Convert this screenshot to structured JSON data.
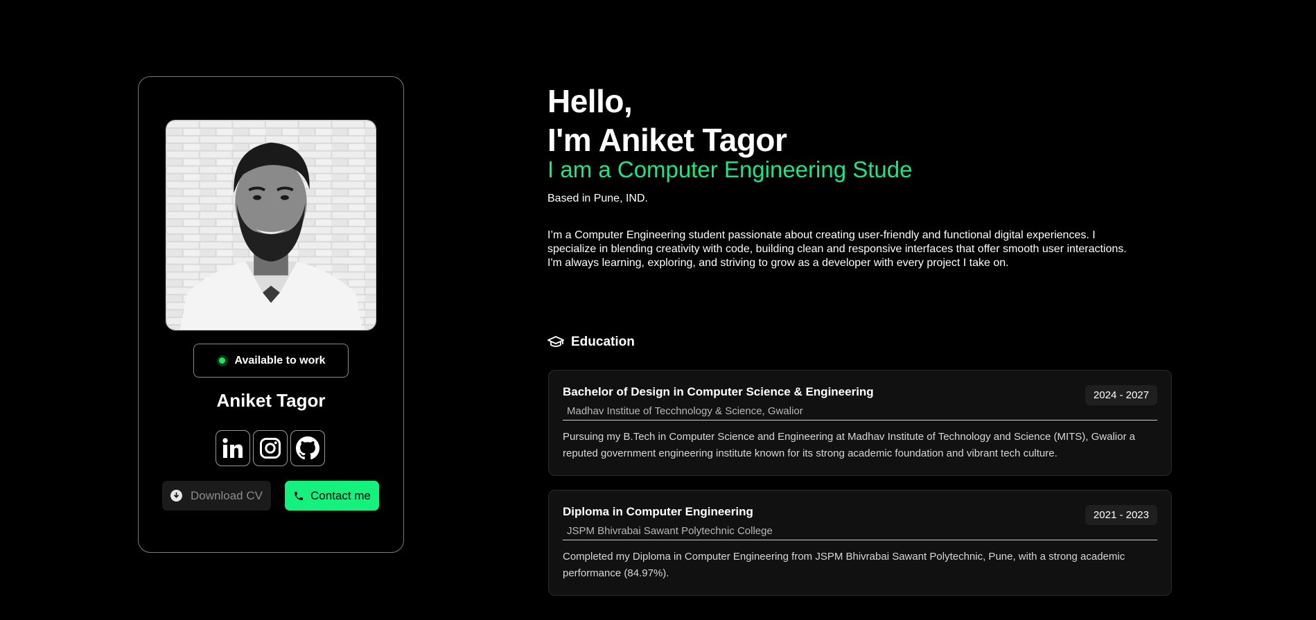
{
  "profile": {
    "photo_alt": "Aniket Tagor portrait",
    "availability": "Available to work",
    "name": "Aniket Tagor",
    "socials": [
      {
        "icon": "linkedin-icon",
        "label": "LinkedIn"
      },
      {
        "icon": "instagram-icon",
        "label": "Instagram"
      },
      {
        "icon": "github-icon",
        "label": "GitHub"
      }
    ],
    "download_label": "Download CV",
    "contact_label": "Contact me"
  },
  "hero": {
    "greeting": "Hello,",
    "intro": "I'm Aniket Tagor",
    "tagline": "I am a Computer Engineering Stude",
    "location": "Based in Pune, IND.",
    "bio": "I’m a Computer Engineering student passionate about creating user-friendly and functional digital experiences. I specialize in blending creativity with code, building clean and responsive interfaces that offer smooth user interactions. I'm always learning, exploring, and striving to grow as a developer with every project I take on."
  },
  "education": {
    "heading": "Education",
    "items": [
      {
        "degree": "Bachelor of Design in Computer Science & Engineering",
        "institution": "Madhav Institue of Tecchnology & Science, Gwalior",
        "years": "2024 - 2027",
        "description": "Pursuing my B.Tech in Computer Science and Engineering at Madhav Institute of Technology and Science (MITS), Gwalior a reputed government engineering institute known for its strong academic foundation and vibrant tech culture."
      },
      {
        "degree": "Diploma in Computer Engineering",
        "institution": "JSPM Bhivrabai Sawant Polytechnic College",
        "years": "2021 - 2023",
        "description": "Completed my Diploma in Computer Engineering from JSPM Bhivrabai Sawant Polytechnic, Pune, with a strong academic performance (84.97%)."
      }
    ]
  },
  "colors": {
    "background": "#000000",
    "accent": "#15f17d",
    "tagline": "#18e884",
    "status_dot": "#1ee35c",
    "card_bg": "#111111"
  }
}
